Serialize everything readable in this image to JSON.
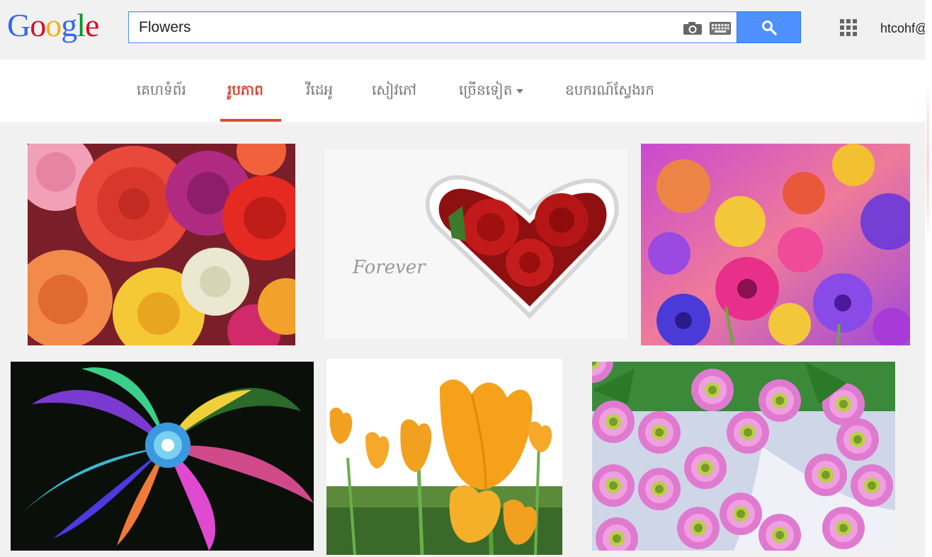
{
  "logo": {
    "letters": [
      "G",
      "o",
      "o",
      "g",
      "l",
      "e"
    ],
    "colors": [
      "#3369e8",
      "#d50f25",
      "#eeb211",
      "#3369e8",
      "#009925",
      "#d50f25"
    ]
  },
  "search": {
    "query": "Flowers",
    "camera_icon": "camera-icon",
    "keyboard_icon": "keyboard-icon",
    "button_icon": "search-icon",
    "accent": "#4d90fe"
  },
  "header": {
    "apps_icon": "apps-grid-icon",
    "user": "htcohf@"
  },
  "tabs": [
    {
      "label": "គេហទំព័រ",
      "active": false
    },
    {
      "label": "រូបភាព",
      "active": true
    },
    {
      "label": "វីដេអូ",
      "active": false
    },
    {
      "label": "សៀវភៅ",
      "active": false
    },
    {
      "label": "ច្រើនទៀត",
      "active": false,
      "dropdown": true
    },
    {
      "label": "ឧបករណ៍ស្វែងរក",
      "active": false
    }
  ],
  "active_color": "#dd4b39",
  "images": [
    {
      "subject": "roses"
    },
    {
      "subject": "heart-roses",
      "caption": "Forever"
    },
    {
      "subject": "colorful-blossoms"
    },
    {
      "subject": "fractal-flower"
    },
    {
      "subject": "orange-tulips"
    },
    {
      "subject": "pink-chrysanthemums"
    }
  ]
}
